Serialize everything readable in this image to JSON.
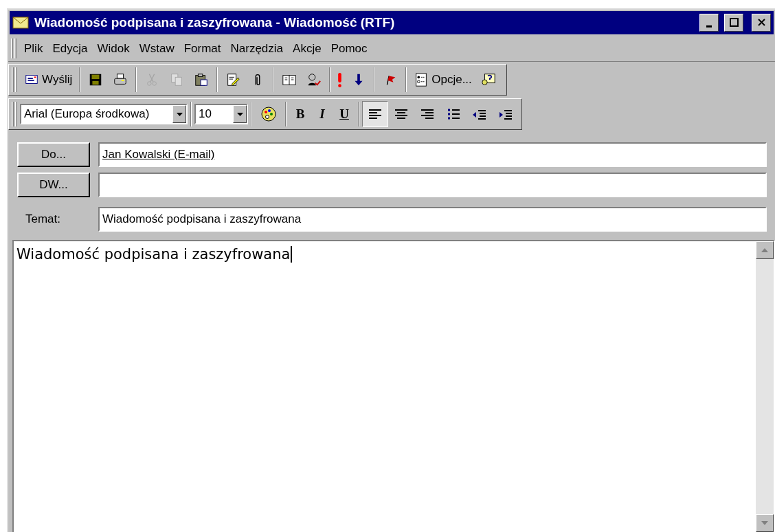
{
  "window": {
    "title": "Wiadomość podpisana i zaszyfrowana - Wiadomość (RTF)"
  },
  "menu": [
    "Plik",
    "Edycja",
    "Widok",
    "Wstaw",
    "Format",
    "Narzędzia",
    "Akcje",
    "Pomoc"
  ],
  "standard_toolbar": [
    {
      "kind": "labeled",
      "label": "Wyślij",
      "disabled": false
    },
    {
      "kind": "separator"
    },
    {
      "kind": "icon",
      "disabled": false
    },
    {
      "kind": "icon",
      "disabled": false
    },
    {
      "kind": "separator"
    },
    {
      "kind": "icon",
      "disabled": true
    },
    {
      "kind": "icon",
      "disabled": true
    },
    {
      "kind": "icon",
      "disabled": false
    },
    {
      "kind": "separator"
    },
    {
      "kind": "icon",
      "disabled": false
    },
    {
      "kind": "icon",
      "disabled": false
    },
    {
      "kind": "separator"
    },
    {
      "kind": "icon",
      "disabled": false
    },
    {
      "kind": "icon",
      "disabled": false
    },
    {
      "kind": "separator"
    },
    {
      "kind": "icon",
      "disabled": false
    },
    {
      "kind": "icon",
      "disabled": false
    },
    {
      "kind": "separator"
    },
    {
      "kind": "icon",
      "disabled": false
    },
    {
      "kind": "separator"
    },
    {
      "kind": "labeled",
      "label": "Opcje...",
      "disabled": false
    },
    {
      "kind": "icon",
      "disabled": false
    }
  ],
  "format_toolbar": {
    "font": "Arial (Europa środkowa)",
    "size": "10",
    "style_buttons": [
      {
        "label": "B",
        "selected": false
      },
      {
        "label": "I",
        "selected": false
      },
      {
        "label": "U",
        "selected": false
      }
    ],
    "align_buttons": [
      {
        "selected": true
      },
      {
        "selected": false
      },
      {
        "selected": false
      },
      {
        "selected": false
      },
      {
        "selected": false
      },
      {
        "selected": false
      }
    ]
  },
  "fields": [
    {
      "kind": "button",
      "label": "Do...",
      "value": "Jan Kowalski (E-mail)"
    },
    {
      "kind": "button",
      "label": "DW..."
    },
    {
      "kind": "label",
      "label": "Temat:",
      "value": "Wiadomość podpisana i zaszyfrowana"
    }
  ],
  "body": {
    "text": "Wiadomość podpisana i zaszyfrowana"
  }
}
